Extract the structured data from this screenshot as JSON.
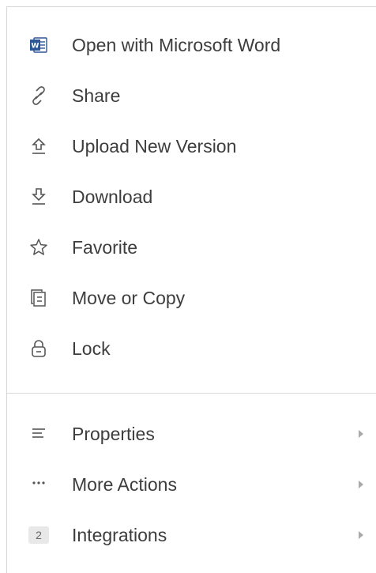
{
  "menu": {
    "items": [
      {
        "label": "Open with Microsoft Word",
        "icon": "word-icon"
      },
      {
        "label": "Share",
        "icon": "link-icon"
      },
      {
        "label": "Upload New Version",
        "icon": "upload-icon"
      },
      {
        "label": "Download",
        "icon": "download-icon"
      },
      {
        "label": "Favorite",
        "icon": "star-icon"
      },
      {
        "label": "Move or Copy",
        "icon": "move-copy-icon"
      },
      {
        "label": "Lock",
        "icon": "lock-icon"
      }
    ],
    "more": [
      {
        "label": "Properties",
        "icon": "properties-icon"
      },
      {
        "label": "More Actions",
        "icon": "more-icon"
      },
      {
        "label": "Integrations",
        "icon": "integrations-badge",
        "badge": "2"
      }
    ]
  },
  "colors": {
    "word_blue": "#2b5797",
    "icon_gray": "#555555",
    "text": "#3d3d3d",
    "divider": "#d9d9d9"
  }
}
